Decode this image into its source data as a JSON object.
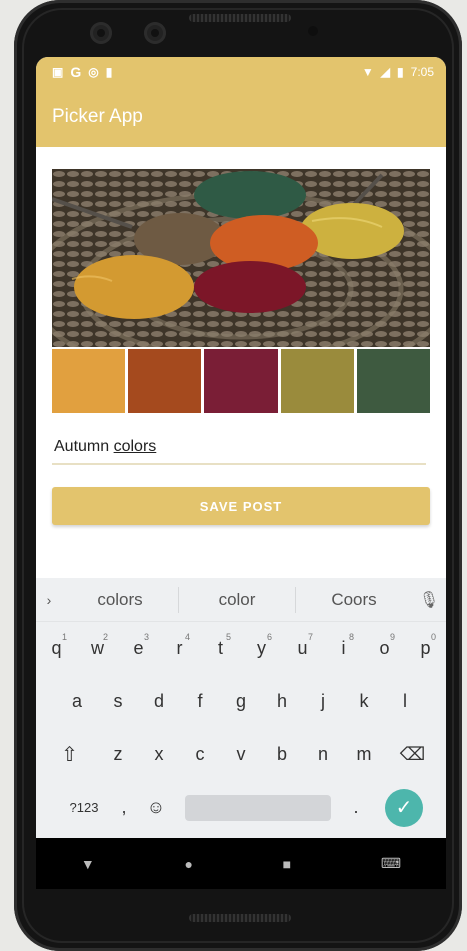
{
  "status_bar": {
    "time": "7:05",
    "left_icons": [
      "image-icon",
      "google-icon",
      "circle-icon",
      "lock-icon"
    ],
    "right_icons": [
      "wifi-icon",
      "signal-icon",
      "battery-icon"
    ]
  },
  "app_bar": {
    "title": "Picker App"
  },
  "image": {
    "subject": "yarn-balls-photo"
  },
  "palette": {
    "colors": [
      "#e1a03f",
      "#a54a1e",
      "#7a1e36",
      "#9a8b3c",
      "#3e5a40"
    ]
  },
  "caption_input": {
    "text_prefix": "Autumn ",
    "text_suggest": "colors"
  },
  "save_button": {
    "label": "SAVE POST"
  },
  "colors": {
    "accent": "#e3c46d",
    "enter_key": "#4db6ac"
  },
  "keyboard": {
    "suggestions": [
      "colors",
      "color",
      "Coors"
    ],
    "row1": [
      {
        "k": "q",
        "n": "1"
      },
      {
        "k": "w",
        "n": "2"
      },
      {
        "k": "e",
        "n": "3"
      },
      {
        "k": "r",
        "n": "4"
      },
      {
        "k": "t",
        "n": "5"
      },
      {
        "k": "y",
        "n": "6"
      },
      {
        "k": "u",
        "n": "7"
      },
      {
        "k": "i",
        "n": "8"
      },
      {
        "k": "o",
        "n": "9"
      },
      {
        "k": "p",
        "n": "0"
      }
    ],
    "row2": [
      "a",
      "s",
      "d",
      "f",
      "g",
      "h",
      "j",
      "k",
      "l"
    ],
    "row3": [
      "z",
      "x",
      "c",
      "v",
      "b",
      "n",
      "m"
    ],
    "symbols_label": "?123",
    "comma": ",",
    "period": "."
  }
}
